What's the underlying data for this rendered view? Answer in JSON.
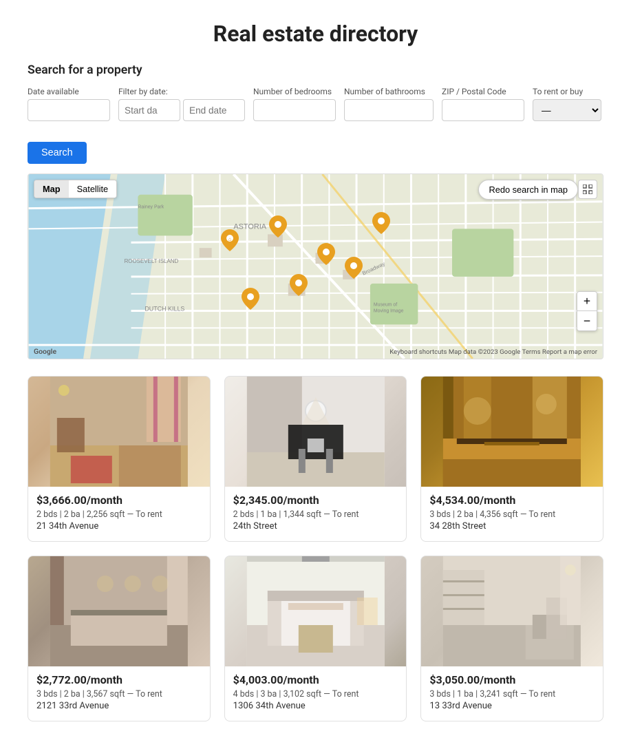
{
  "page": {
    "title": "Real estate directory",
    "search_section_label": "Search for a property"
  },
  "filters": {
    "date_available_label": "Date available",
    "date_available_placeholder": "",
    "filter_by_date_label": "Filter by date:",
    "start_date_placeholder": "Start da",
    "end_date_placeholder": "End date",
    "bedrooms_label": "Number of bedrooms",
    "bedrooms_placeholder": "",
    "bathrooms_label": "Number of bathrooms",
    "bathrooms_placeholder": "",
    "zip_label": "ZIP / Postal Code",
    "zip_placeholder": "",
    "rent_buy_label": "To rent or buy",
    "rent_buy_value": "—",
    "search_button": "Search"
  },
  "map": {
    "map_tab": "Map",
    "satellite_tab": "Satellite",
    "redo_search": "Redo search in map",
    "zoom_in": "+",
    "zoom_out": "−",
    "attribution": "Keyboard shortcuts  Map data ©2023 Google  Terms  Report a map error",
    "google_logo": "Google"
  },
  "listings": [
    {
      "price": "$3,666.00/month",
      "details": "2 bds | 2 ba | 2,256 sqft — To rent",
      "address": "21 34th Avenue",
      "room_class": "room-1"
    },
    {
      "price": "$2,345.00/month",
      "details": "2 bds | 1 ba | 1,344 sqft — To rent",
      "address": "24th Street",
      "room_class": "room-2"
    },
    {
      "price": "$4,534.00/month",
      "details": "3 bds | 2 ba | 4,356 sqft — To rent",
      "address": "34 28th Street",
      "room_class": "room-3"
    },
    {
      "price": "$2,772.00/month",
      "details": "3 bds | 2 ba | 3,567 sqft — To rent",
      "address": "2121 33rd Avenue",
      "room_class": "room-4"
    },
    {
      "price": "$4,003.00/month",
      "details": "4 bds | 3 ba | 3,102 sqft — To rent",
      "address": "1306 34th Avenue",
      "room_class": "room-5"
    },
    {
      "price": "$3,050.00/month",
      "details": "3 bds | 1 ba | 3,241 sqft — To rent",
      "address": "13 33rd Avenue",
      "room_class": "room-6"
    }
  ]
}
